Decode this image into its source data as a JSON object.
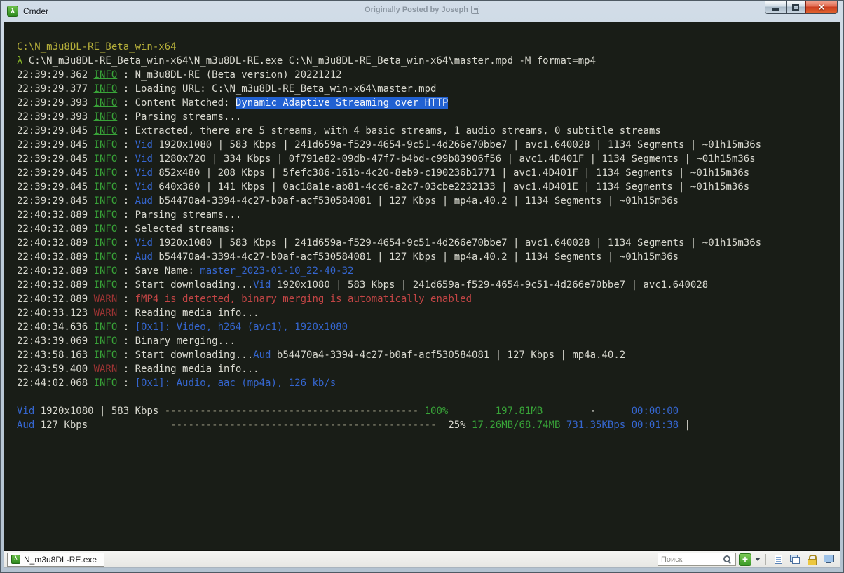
{
  "window": {
    "title": "Cmder",
    "icon_glyph": "λ",
    "watermark": "Originally Posted by Joseph",
    "controls": {
      "minimize": "minimize",
      "maximize": "maximize",
      "close_glyph": "×"
    }
  },
  "palette": {
    "term_bg": "#191d17",
    "fg": "#d8d8cf",
    "yellow": "#b4ae3a",
    "lambda": "#8fc029",
    "info": "#38a338",
    "warn": "#9e3434",
    "red": "#c24545",
    "blue": "#3566cf",
    "green": "#38a338",
    "dash": "#8b8b76",
    "hl_bg": "#2161d2",
    "hl_fg": "#f2f5fa"
  },
  "terminal": {
    "lines": [
      {
        "type": "plain",
        "segments": [
          {
            "text": "C:\\N_m3u8DL-RE_Beta_win-x64",
            "color": "yellow"
          }
        ]
      },
      {
        "type": "plain",
        "segments": [
          {
            "text": "λ ",
            "color": "lambda"
          },
          {
            "text": "C:\\N_m3u8DL-RE_Beta_win-x64\\N_m3u8DL-RE.exe C:\\N_m3u8DL-RE_Beta_win-x64\\master.mpd -M format=mp4",
            "color": "fg"
          }
        ]
      },
      {
        "type": "log",
        "time": "22:39:29.362",
        "level": "INFO",
        "segments": [
          {
            "text": "N_m3u8DL-RE (Beta version) 20221212",
            "color": "fg"
          }
        ]
      },
      {
        "type": "log",
        "time": "22:39:29.377",
        "level": "INFO",
        "segments": [
          {
            "text": "Loading URL: C:\\N_m3u8DL-RE_Beta_win-x64\\master.mpd",
            "color": "fg"
          }
        ]
      },
      {
        "type": "log",
        "time": "22:39:29.393",
        "level": "INFO",
        "segments": [
          {
            "text": "Content Matched: ",
            "color": "fg"
          },
          {
            "text": "Dynamic Adaptive Streaming over HTTP",
            "color": "highlight"
          }
        ]
      },
      {
        "type": "log",
        "time": "22:39:29.393",
        "level": "INFO",
        "segments": [
          {
            "text": "Parsing streams...",
            "color": "fg"
          }
        ]
      },
      {
        "type": "log",
        "time": "22:39:29.845",
        "level": "INFO",
        "segments": [
          {
            "text": "Extracted, there are 5 streams, with 4 basic streams, 1 audio streams, 0 subtitle streams",
            "color": "fg"
          }
        ]
      },
      {
        "type": "log",
        "time": "22:39:29.845",
        "level": "INFO",
        "segments": [
          {
            "text": "Vid",
            "color": "blue"
          },
          {
            "text": " 1920x1080 | 583 Kbps | 241d659a-f529-4654-9c51-4d266e70bbe7 | avc1.640028 | 1134 Segments | ~01h15m36s",
            "color": "fg"
          }
        ]
      },
      {
        "type": "log",
        "time": "22:39:29.845",
        "level": "INFO",
        "segments": [
          {
            "text": "Vid",
            "color": "blue"
          },
          {
            "text": " 1280x720 | 334 Kbps | 0f791e82-09db-47f7-b4bd-c99b83906f56 | avc1.4D401F | 1134 Segments | ~01h15m36s",
            "color": "fg"
          }
        ]
      },
      {
        "type": "log",
        "time": "22:39:29.845",
        "level": "INFO",
        "segments": [
          {
            "text": "Vid",
            "color": "blue"
          },
          {
            "text": " 852x480 | 208 Kbps | 5fefc386-161b-4c20-8eb9-c190236b1771 | avc1.4D401F | 1134 Segments | ~01h15m36s",
            "color": "fg"
          }
        ]
      },
      {
        "type": "log",
        "time": "22:39:29.845",
        "level": "INFO",
        "segments": [
          {
            "text": "Vid",
            "color": "blue"
          },
          {
            "text": " 640x360 | 141 Kbps | 0ac18a1e-ab81-4cc6-a2c7-03cbe2232133 | avc1.4D401E | 1134 Segments | ~01h15m36s",
            "color": "fg"
          }
        ]
      },
      {
        "type": "log",
        "time": "22:39:29.845",
        "level": "INFO",
        "segments": [
          {
            "text": "Aud",
            "color": "blue"
          },
          {
            "text": " b54470a4-3394-4c27-b0af-acf530584081 | 127 Kbps | mp4a.40.2 | 1134 Segments | ~01h15m36s",
            "color": "fg"
          }
        ]
      },
      {
        "type": "log",
        "time": "22:40:32.889",
        "level": "INFO",
        "segments": [
          {
            "text": "Parsing streams...",
            "color": "fg"
          }
        ]
      },
      {
        "type": "log",
        "time": "22:40:32.889",
        "level": "INFO",
        "segments": [
          {
            "text": "Selected streams:",
            "color": "fg"
          }
        ]
      },
      {
        "type": "log",
        "time": "22:40:32.889",
        "level": "INFO",
        "segments": [
          {
            "text": "Vid",
            "color": "blue"
          },
          {
            "text": " 1920x1080 | 583 Kbps | 241d659a-f529-4654-9c51-4d266e70bbe7 | avc1.640028 | 1134 Segments | ~01h15m36s",
            "color": "fg"
          }
        ]
      },
      {
        "type": "log",
        "time": "22:40:32.889",
        "level": "INFO",
        "segments": [
          {
            "text": "Aud",
            "color": "blue"
          },
          {
            "text": " b54470a4-3394-4c27-b0af-acf530584081 | 127 Kbps | mp4a.40.2 | 1134 Segments | ~01h15m36s",
            "color": "fg"
          }
        ]
      },
      {
        "type": "log",
        "time": "22:40:32.889",
        "level": "INFO",
        "segments": [
          {
            "text": "Save Name: ",
            "color": "fg"
          },
          {
            "text": "master_2023-01-10_22-40-32",
            "color": "blue"
          }
        ]
      },
      {
        "type": "log",
        "time": "22:40:32.889",
        "level": "INFO",
        "segments": [
          {
            "text": "Start downloading...",
            "color": "fg"
          },
          {
            "text": "Vid",
            "color": "blue"
          },
          {
            "text": " 1920x1080 | 583 Kbps | 241d659a-f529-4654-9c51-4d266e70bbe7 | avc1.640028",
            "color": "fg"
          }
        ]
      },
      {
        "type": "log",
        "time": "22:40:32.889",
        "level": "WARN",
        "segments": [
          {
            "text": "fMP4 is detected, binary merging is automatically enabled",
            "color": "red"
          }
        ]
      },
      {
        "type": "log",
        "time": "22:40:33.123",
        "level": "WARN",
        "segments": [
          {
            "text": "Reading media info...",
            "color": "fg"
          }
        ]
      },
      {
        "type": "log",
        "time": "22:40:34.636",
        "level": "INFO",
        "segments": [
          {
            "text": "[0x1]: Video, h264 (avc1), 1920x1080",
            "color": "blue"
          }
        ]
      },
      {
        "type": "log",
        "time": "22:43:39.069",
        "level": "INFO",
        "segments": [
          {
            "text": "Binary merging...",
            "color": "fg"
          }
        ]
      },
      {
        "type": "log",
        "time": "22:43:58.163",
        "level": "INFO",
        "segments": [
          {
            "text": "Start downloading...",
            "color": "fg"
          },
          {
            "text": "Aud",
            "color": "blue"
          },
          {
            "text": " b54470a4-3394-4c27-b0af-acf530584081 | 127 Kbps | mp4a.40.2",
            "color": "fg"
          }
        ]
      },
      {
        "type": "log",
        "time": "22:43:59.400",
        "level": "WARN",
        "segments": [
          {
            "text": "Reading media info...",
            "color": "fg"
          }
        ]
      },
      {
        "type": "log",
        "time": "22:44:02.068",
        "level": "INFO",
        "segments": [
          {
            "text": "[0x1]: Audio, aac (mp4a), 126 kb/s",
            "color": "blue"
          }
        ]
      },
      {
        "type": "blank",
        "segments": []
      },
      {
        "type": "plain",
        "segments": [
          {
            "text": "Vid",
            "color": "blue"
          },
          {
            "text": " 1920x1080 | 583 Kbps ",
            "color": "fg"
          },
          {
            "text": "-------------------------------------------",
            "color": "dash"
          },
          {
            "text": " 100%",
            "color": "green"
          },
          {
            "text": "        197.81MB",
            "color": "green"
          },
          {
            "text": "        -",
            "color": "fg"
          },
          {
            "text": "      00:00:00",
            "color": "blue"
          }
        ]
      },
      {
        "type": "plain",
        "segments": [
          {
            "text": "Aud",
            "color": "blue"
          },
          {
            "text": " 127 Kbps              ",
            "color": "fg"
          },
          {
            "text": "---------------------------------------------",
            "color": "dash"
          },
          {
            "text": "  25%",
            "color": "fg"
          },
          {
            "text": " 17.26MB/68.74MB",
            "color": "green"
          },
          {
            "text": " 731.35KBps",
            "color": "blue"
          },
          {
            "text": " 00:01:38",
            "color": "blue"
          },
          {
            "text": " |",
            "color": "fg"
          }
        ]
      }
    ]
  },
  "taskbar": {
    "tab_label": "N_m3u8DL-RE.exe",
    "tab_icon_glyph": "λ",
    "search_placeholder": "Поиск",
    "new_console_label": "+",
    "icons": [
      "search-icon",
      "new-console-plus-icon",
      "tabs-list-icon",
      "windows-mode-icon",
      "lock-icon",
      "monitor-icon"
    ]
  }
}
